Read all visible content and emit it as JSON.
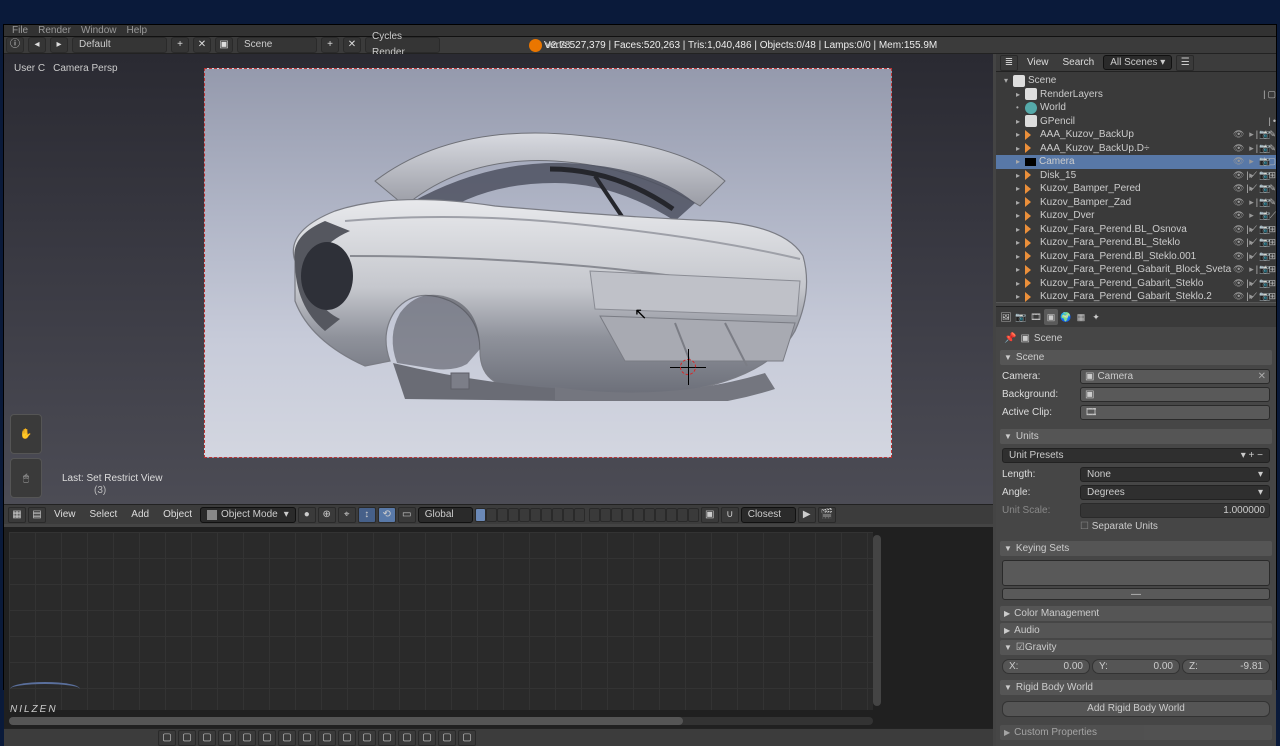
{
  "top_menu": {
    "items": [
      "File",
      "Render",
      "Window",
      "Help"
    ]
  },
  "info_bar": {
    "layout": "Default",
    "scene": "Scene",
    "engine": "Cycles Render",
    "version": "v2.78",
    "stats": "Verts:527,379 | Faces:520,263 | Tris:1,040,486 | Objects:0/48 | Lamps:0/0 | Mem:155.9M"
  },
  "viewport": {
    "label_left": "User C",
    "label_right": "Camera Persp",
    "last_op": "Last: Set Restrict View",
    "last_op_num": "(3)"
  },
  "view_header": {
    "menus": [
      "View",
      "Select",
      "Add",
      "Object"
    ],
    "mode": "Object Mode",
    "orientation": "Global",
    "snap": "Closest"
  },
  "outliner_hdr": {
    "menus": [
      "View",
      "Search"
    ],
    "filter": "All Scenes"
  },
  "outliner": [
    {
      "d": 0,
      "t": "scene",
      "name": "Scene",
      "tri": "▾"
    },
    {
      "d": 1,
      "t": "layer",
      "name": "RenderLayers",
      "tri": "▸",
      "post": [
        "|",
        "▢"
      ]
    },
    {
      "d": 1,
      "t": "world",
      "name": "World"
    },
    {
      "d": 1,
      "t": "gp",
      "name": "GPencil",
      "tri": "▸",
      "post": [
        "|",
        "•"
      ]
    },
    {
      "d": 1,
      "t": "mesh",
      "name": "AAA_Kuzov_BackUp",
      "tri": "▸",
      "post": [
        "|",
        "⟋",
        "✎"
      ],
      "rest": true
    },
    {
      "d": 1,
      "t": "mesh",
      "name": "AAA_Kuzov_BackUp.D÷",
      "tri": "▸",
      "post": [
        "|",
        "⟋",
        "✎"
      ],
      "rest": true
    },
    {
      "d": 1,
      "t": "cam",
      "name": "Camera",
      "tri": "▸",
      "post": [
        "|",
        "▢"
      ],
      "sel": true,
      "rest": true
    },
    {
      "d": 1,
      "t": "mesh",
      "name": "Disk_15",
      "tri": "▸",
      "post": [
        "|",
        "⟋",
        "✎",
        "⊞"
      ],
      "rest": true
    },
    {
      "d": 1,
      "t": "mesh",
      "name": "Kuzov_Bamper_Pered",
      "tri": "▸",
      "post": [
        "|",
        "⟋",
        "✎",
        "✎"
      ],
      "rest": true
    },
    {
      "d": 1,
      "t": "mesh",
      "name": "Kuzov_Bamper_Zad",
      "tri": "▸",
      "post": [
        "|",
        "⟋",
        "✎"
      ],
      "rest": true
    },
    {
      "d": 1,
      "t": "mesh",
      "name": "Kuzov_Dver",
      "tri": "▸",
      "post": [
        "|",
        "⟋"
      ],
      "rest": true
    },
    {
      "d": 1,
      "t": "mesh",
      "name": "Kuzov_Fara_Perend.BL_Osnova",
      "tri": "▸",
      "post": [
        "|",
        "⟋",
        "✎",
        "⊞"
      ],
      "rest": true
    },
    {
      "d": 1,
      "t": "mesh",
      "name": "Kuzov_Fara_Perend.BL_Steklo",
      "tri": "▸",
      "post": [
        "|",
        "⟋",
        "✎",
        "⊞"
      ],
      "rest": true
    },
    {
      "d": 1,
      "t": "mesh",
      "name": "Kuzov_Fara_Perend.Bl_Steklo.001",
      "tri": "▸",
      "post": [
        "|",
        "⟋",
        "✎",
        "⊞"
      ],
      "rest": true
    },
    {
      "d": 1,
      "t": "mesh",
      "name": "Kuzov_Fara_Perend_Gabarit_Block_Sveta",
      "tri": "▸",
      "post": [
        "|",
        "⟋",
        "⊞"
      ],
      "rest": true
    },
    {
      "d": 1,
      "t": "mesh",
      "name": "Kuzov_Fara_Perend_Gabarit_Steklo",
      "tri": "▸",
      "post": [
        "|",
        "⟋",
        "✎",
        "⊞"
      ],
      "rest": true
    },
    {
      "d": 1,
      "t": "mesh",
      "name": "Kuzov_Fara_Perend_Gabarit_Steklo.2",
      "tri": "▸",
      "post": [
        "|",
        "⟋",
        "✎",
        "⊞"
      ],
      "rest": true
    }
  ],
  "props": {
    "crumb": "Scene",
    "scene": {
      "title": "Scene",
      "camera_label": "Camera:",
      "camera": "Camera",
      "bg_label": "Background:",
      "clip_label": "Active Clip:"
    },
    "units": {
      "title": "Units",
      "presets": "Unit Presets",
      "length_label": "Length:",
      "length": "None",
      "angle_label": "Angle:",
      "angle": "Degrees",
      "scale_label": "Unit Scale:",
      "scale": "1.000000",
      "sep": "Separate Units"
    },
    "keying": {
      "title": "Keying Sets"
    },
    "color": {
      "title": "Color Management"
    },
    "audio": {
      "title": "Audio"
    },
    "gravity": {
      "title": "Gravity",
      "x": "0.00",
      "y": "0.00",
      "z": "-9.81"
    },
    "rigid": {
      "title": "Rigid Body World",
      "btn": "Add Rigid Body World"
    },
    "custom": {
      "title": "Custom Properties"
    }
  },
  "watermark": "NILZEN"
}
